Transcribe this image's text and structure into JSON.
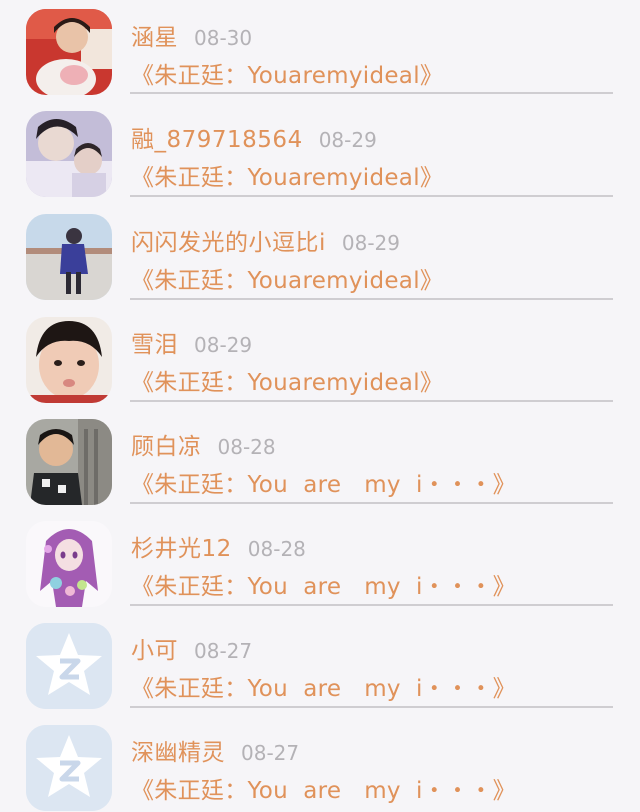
{
  "comments": [
    {
      "name": "涵星",
      "date": "08-30",
      "message": "《朱正廷：Youaremyideal》",
      "avatar": "photo-girl-red"
    },
    {
      "name": "融_879718564",
      "date": "08-29",
      "message": "《朱正廷：Youaremyideal》",
      "avatar": "photo-couple-purple"
    },
    {
      "name": "闪闪发光的小逗比i",
      "date": "08-29",
      "message": "《朱正廷：Youaremyideal》",
      "avatar": "photo-child-outdoor"
    },
    {
      "name": "雪泪",
      "date": "08-29",
      "message": "《朱正廷：Youaremyideal》",
      "avatar": "photo-girl-face"
    },
    {
      "name": "顾白凉",
      "date": "08-28",
      "message": "《朱正廷：You  are   my  i・・・》",
      "avatar": "photo-boy-outdoor"
    },
    {
      "name": "杉井光12",
      "date": "08-28",
      "message": "《朱正廷：You  are   my  i・・・》",
      "avatar": "anime-girl-purple"
    },
    {
      "name": "小可",
      "date": "08-27",
      "message": "《朱正廷：You  are   my  i・・・》",
      "avatar": "default-star-icon"
    },
    {
      "name": "深幽精灵",
      "date": "08-27",
      "message": "《朱正廷：You  are   my  i・・・》",
      "avatar": "default-star-icon"
    }
  ],
  "colors": {
    "name": "#e0925a",
    "date": "#b4b2b6",
    "divider": "#cfcdd1",
    "background": "#f6f5f8",
    "default_avatar": "#dce6f2"
  }
}
